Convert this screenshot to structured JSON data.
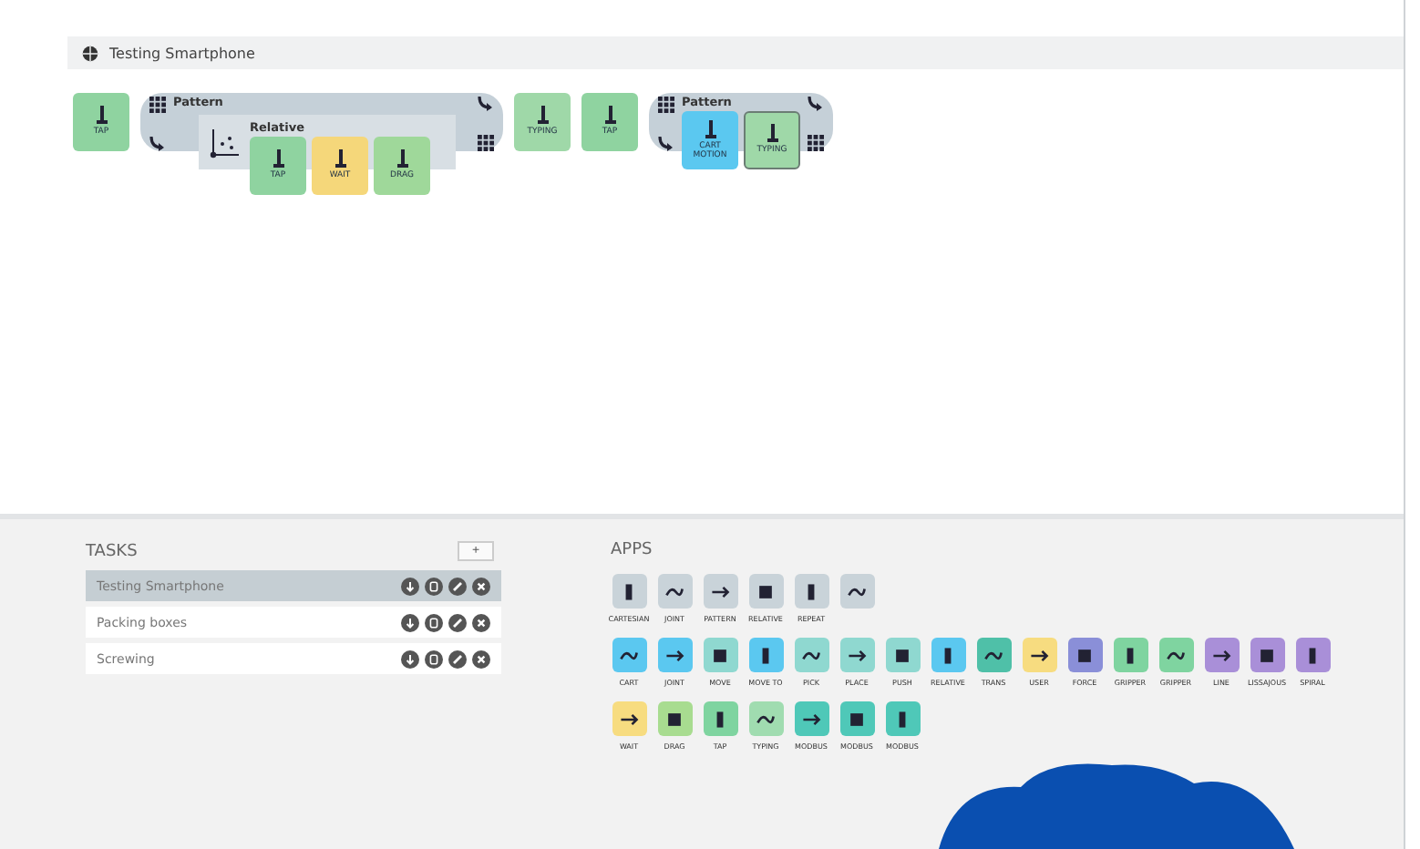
{
  "window": {
    "title": "Testing Smartphone"
  },
  "program": [
    {
      "kind": "block",
      "label": "TAP",
      "color": "#8fd3a0",
      "selected": false
    },
    {
      "kind": "pattern",
      "title": "Pattern",
      "children": [
        {
          "kind": "relative",
          "title": "Relative",
          "children": [
            {
              "kind": "block",
              "label": "TAP",
              "color": "#8fd3a0",
              "selected": false
            },
            {
              "kind": "block",
              "label": "WAIT",
              "color": "#f5d77a",
              "selected": false
            },
            {
              "kind": "block",
              "label": "DRAG",
              "color": "#9fd89a",
              "selected": false
            }
          ]
        }
      ]
    },
    {
      "kind": "block",
      "label": "TYPING",
      "color": "#9fd8a8",
      "selected": false
    },
    {
      "kind": "block",
      "label": "TAP",
      "color": "#8fd3a0",
      "selected": false
    },
    {
      "kind": "pattern",
      "title": "Pattern",
      "children": [
        {
          "kind": "block",
          "label": "CART MOTION",
          "color": "#5bc8f0",
          "selected": false
        },
        {
          "kind": "block",
          "label": "TYPING",
          "color": "#9fd8a8",
          "selected": true
        }
      ]
    }
  ],
  "tasks": {
    "title": "TASKS",
    "add_button": "+",
    "items": [
      {
        "label": "Testing Smartphone",
        "selected": true
      },
      {
        "label": "Packing boxes",
        "selected": false
      },
      {
        "label": "Screwing",
        "selected": false
      }
    ]
  },
  "apps": {
    "title": "APPS",
    "rows": [
      [
        {
          "label": "CARTESIAN",
          "color": "#c9d3d9"
        },
        {
          "label": "JOINT",
          "color": "#c9d3d9"
        },
        {
          "label": "PATTERN",
          "color": "#c9d3d9"
        },
        {
          "label": "RELATIVE",
          "color": "#c9d3d9"
        },
        {
          "label": "REPEAT",
          "color": "#c9d3d9"
        },
        {
          "color": "#c9d3d9"
        }
      ],
      [
        {
          "label": "CART",
          "color": "#5bc8f0"
        },
        {
          "label": "JOINT",
          "color": "#5bc8f0"
        },
        {
          "label": "MOVE",
          "color": "#8fd8d0"
        },
        {
          "label": "MOVE TO",
          "color": "#5bc8f0"
        },
        {
          "label": "PICK",
          "color": "#8fd8d0"
        },
        {
          "label": "PLACE",
          "color": "#8fd8d0"
        },
        {
          "label": "PUSH",
          "color": "#8fd8d0"
        },
        {
          "label": "RELATIVE",
          "color": "#5bc8f0"
        },
        {
          "label": "TRANS",
          "color": "#4fc0a8"
        },
        {
          "label": "USER",
          "color": "#f7dc80"
        },
        {
          "label": "FORCE",
          "color": "#8a8fd8"
        },
        {
          "label": "GRIPPER",
          "color": "#7fd4a0"
        },
        {
          "label": "GRIPPER",
          "color": "#7fd4a0"
        },
        {
          "label": "LINE",
          "color": "#a98fd8"
        },
        {
          "label": "LISSAJOUS",
          "color": "#a98fd8"
        },
        {
          "label": "SPIRAL",
          "color": "#a98fd8"
        }
      ],
      [
        {
          "label": "WAIT",
          "color": "#f7dc80"
        },
        {
          "label": "DRAG",
          "color": "#a8dc90"
        },
        {
          "label": "TAP",
          "color": "#7fd4a0"
        },
        {
          "label": "TYPING",
          "color": "#a0dcb0"
        },
        {
          "label": "MODBUS",
          "color": "#4fc8b8"
        },
        {
          "label": "MODBUS",
          "color": "#4fc8b8"
        },
        {
          "label": "MODBUS",
          "color": "#4fc8b8"
        }
      ]
    ]
  }
}
